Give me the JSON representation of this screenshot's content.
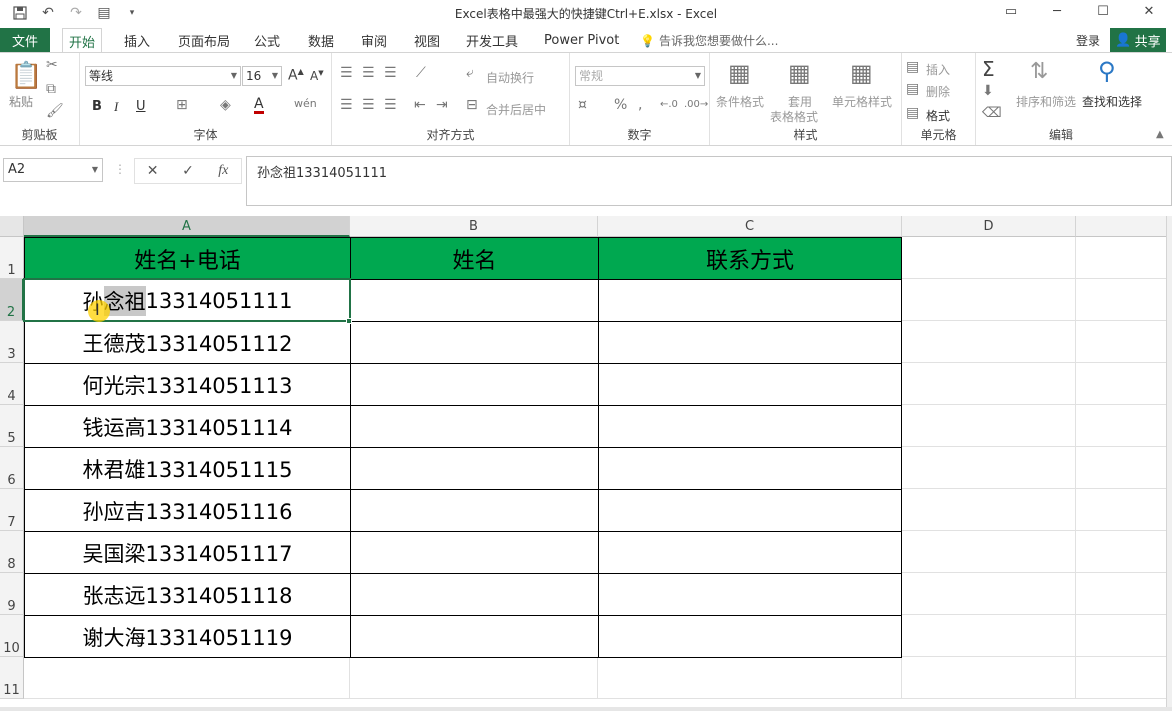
{
  "window": {
    "title": "Excel表格中最强大的快捷键Ctrl+E.xlsx - Excel"
  },
  "tabs": {
    "file": "文件",
    "items": [
      "开始",
      "插入",
      "页面布局",
      "公式",
      "数据",
      "审阅",
      "视图",
      "开发工具",
      "Power Pivot"
    ],
    "active": "开始",
    "tell_me": "告诉我您想要做什么...",
    "login": "登录",
    "share": "共享"
  },
  "ribbon": {
    "clipboard": {
      "label": "剪贴板",
      "paste": "粘贴"
    },
    "font": {
      "label": "字体",
      "font_name": "等线",
      "font_size": "16",
      "bold": "B",
      "italic": "I",
      "underline": "U"
    },
    "alignment": {
      "label": "对齐方式",
      "wrap": "自动换行",
      "merge": "合并后居中"
    },
    "number": {
      "label": "数字",
      "format": "常规"
    },
    "styles": {
      "label": "样式",
      "conditional": "条件格式",
      "table_line1": "套用",
      "table_line2": "表格格式",
      "cell_styles": "单元格样式"
    },
    "cells": {
      "label": "单元格",
      "insert": "插入",
      "delete": "删除",
      "format": "格式"
    },
    "editing": {
      "label": "编辑",
      "sort": "排序和筛选",
      "find": "查找和选择"
    }
  },
  "formula_bar": {
    "name_box": "A2",
    "fx": "fx",
    "content": "孙念祖13314051111"
  },
  "sheet": {
    "columns": [
      "A",
      "B",
      "C",
      "D"
    ],
    "rows": [
      "1",
      "2",
      "3",
      "4",
      "5",
      "6",
      "7",
      "8",
      "9",
      "10",
      "11"
    ],
    "headers": [
      "姓名+电话",
      "姓名",
      "联系方式"
    ],
    "data": [
      "孙念祖13314051111",
      "王德茂13314051112",
      "何光宗13314051113",
      "钱运高13314051114",
      "林君雄13314051115",
      "孙应吉13314051116",
      "吴国梁13314051117",
      "张志远13314051118",
      "谢大海13314051119"
    ],
    "first_cell_parts": {
      "before": "孙",
      "highlight": "念祖",
      "after": "13314051111"
    },
    "header_fill": "#00a850",
    "selection_color": "#217346"
  }
}
